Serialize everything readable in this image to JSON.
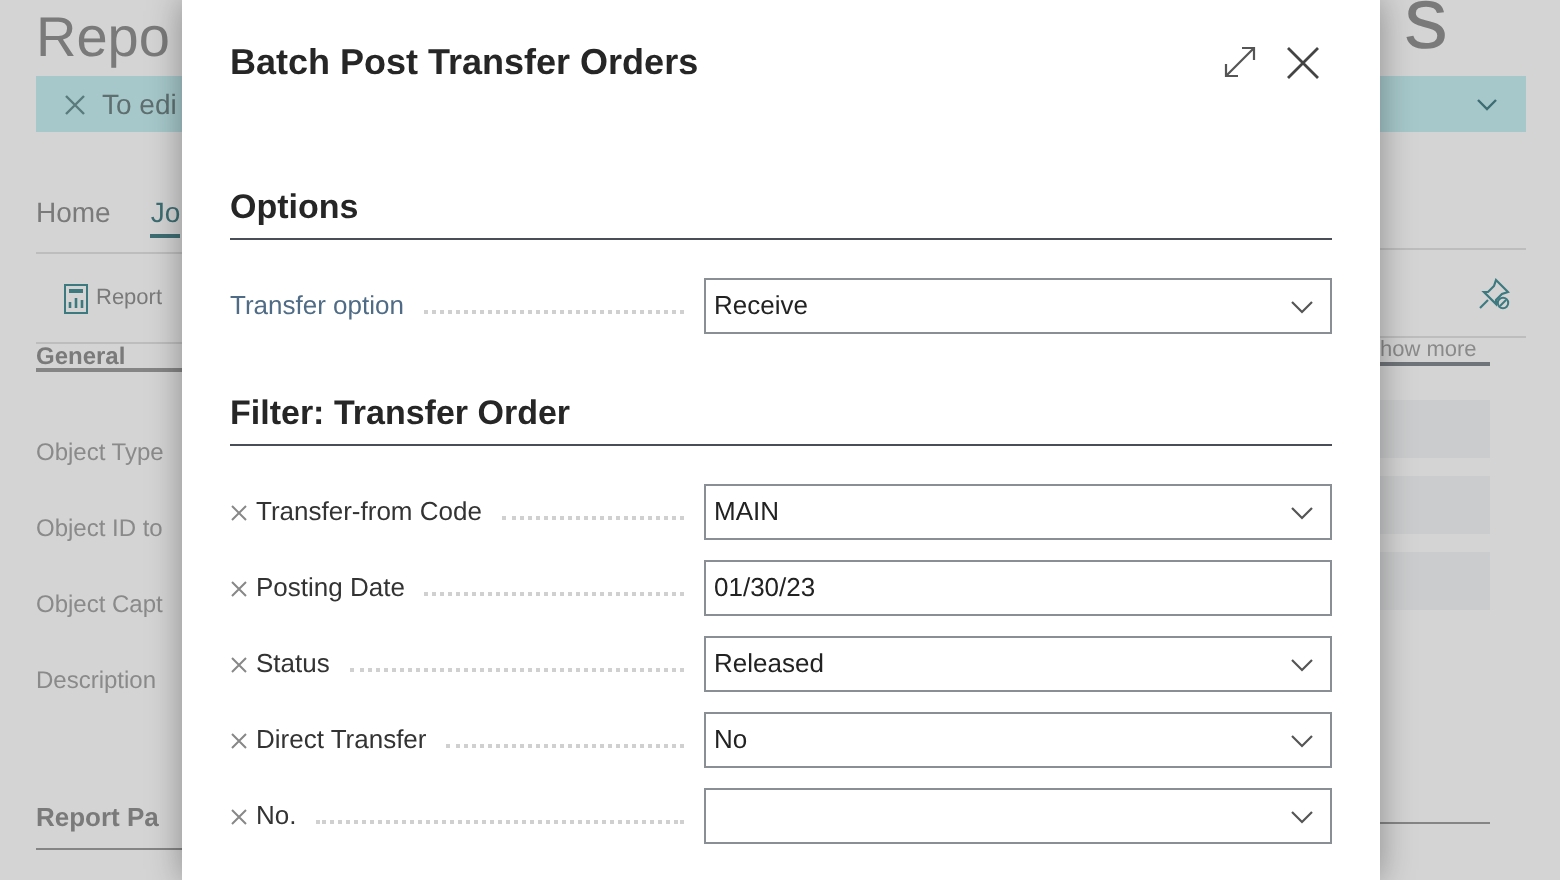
{
  "background": {
    "title": "Repo",
    "title_end": "s",
    "banner": "To edi",
    "tabs": [
      {
        "label": "Home",
        "selected": false
      },
      {
        "label": "Jo",
        "selected": true
      }
    ],
    "action": "Report",
    "section": "General",
    "show_more": "how more",
    "fields": [
      "Object Type",
      "Object ID to",
      "Object Capt",
      "Description"
    ],
    "section_2": "Report Pa"
  },
  "dialog": {
    "title": "Batch Post Transfer Orders",
    "sections": [
      {
        "title": "Options",
        "rows": [
          {
            "label": "Transfer option",
            "kind": "dropdown",
            "value": "Receive",
            "removable": false
          }
        ]
      },
      {
        "title": "Filter: Transfer Order",
        "rows": [
          {
            "label": "Transfer-from Code",
            "kind": "dropdown",
            "value": "MAIN",
            "removable": true
          },
          {
            "label": "Posting Date",
            "kind": "text",
            "value": "01/30/23",
            "removable": true
          },
          {
            "label": "Status",
            "kind": "dropdown",
            "value": "Released",
            "removable": true
          },
          {
            "label": "Direct Transfer",
            "kind": "dropdown",
            "value": "No",
            "removable": true
          },
          {
            "label": "No.",
            "kind": "dropdown",
            "removable": true
          }
        ]
      }
    ]
  }
}
